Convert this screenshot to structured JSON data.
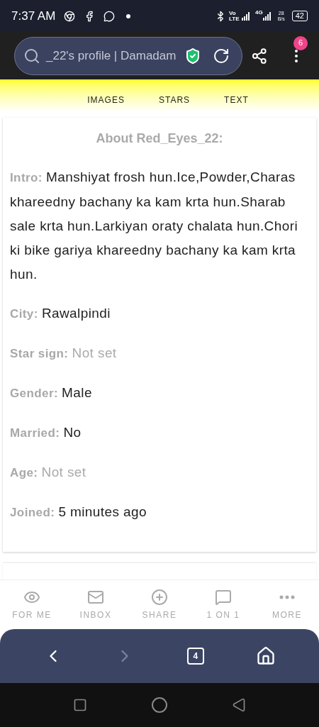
{
  "status_bar": {
    "time": "7:37 AM",
    "volte": "Vo LTE",
    "network": "4G",
    "speed": "28 B/s",
    "battery": "42"
  },
  "address_bar": {
    "value": "_22's profile | Damadam",
    "menu_badge": "6"
  },
  "tabs": [
    {
      "label": "IMAGES",
      "selected": false
    },
    {
      "label": "STARS",
      "selected": false
    },
    {
      "label": "TEXT",
      "selected": false
    }
  ],
  "about": {
    "title": "About Red_Eyes_22:",
    "fields": [
      {
        "label": "Intro:",
        "value": "Manshiyat frosh hun.Ice,Powder,Charas khareedny bachany ka kam krta hun.Sharab sale krta hun.Larkiyan oraty chalata hun.Chori ki bike gariya khareedny bachany ka kam krta hun.",
        "set": true
      },
      {
        "label": "City:",
        "value": "Rawalpindi",
        "set": true
      },
      {
        "label": "Star sign:",
        "value": "Not set",
        "set": false
      },
      {
        "label": "Gender:",
        "value": "Male",
        "set": true
      },
      {
        "label": "Married:",
        "value": "No",
        "set": true
      },
      {
        "label": "Age:",
        "value": "Not set",
        "set": false
      },
      {
        "label": "Joined:",
        "value": "5 minutes ago",
        "set": true
      }
    ]
  },
  "bottom_nav": [
    {
      "kind": "eye",
      "label": "FOR ME"
    },
    {
      "kind": "mail",
      "label": "INBOX"
    },
    {
      "kind": "plus",
      "label": "SHARE"
    },
    {
      "kind": "chat",
      "label": "1 ON 1"
    },
    {
      "kind": "dots",
      "label": "MORE"
    }
  ],
  "browser_nav": {
    "back_enabled": true,
    "forward_enabled": false,
    "tab_count": "4"
  }
}
